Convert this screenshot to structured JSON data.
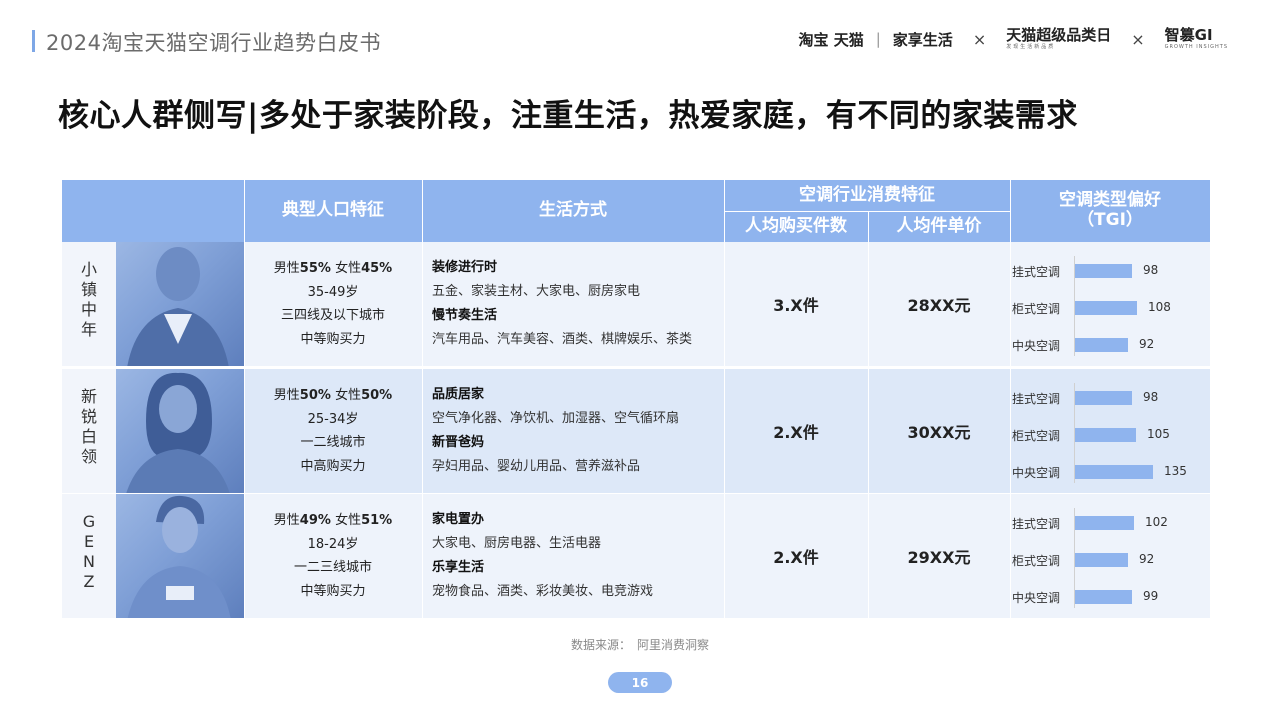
{
  "header": {
    "report_title": "2024淘宝天猫空调行业趋势白皮书",
    "logo_taobao_tmall": "淘宝 天猫",
    "logo_jiaxiang": "家享生活",
    "logo_super": "天猫超级品类日",
    "logo_super_sub": "发现生活新品质",
    "logo_zhisuan": "智篡GI",
    "logo_zhisuan_sub": "GROWTH INSIGHTS",
    "x_symbol": "×"
  },
  "headline": "核心人群侧写|多处于家装阶段，注重生活，热爱家庭，有不同的家装需求",
  "table": {
    "headers": {
      "demographics": "典型人口特征",
      "lifestyle": "生活方式",
      "consumption": "空调行业消费特征",
      "per_capita_qty": "人均购买件数",
      "per_capita_price": "人均件单价",
      "preference": "空调类型偏好",
      "preference_sub": "（TGI）"
    },
    "rows": [
      {
        "segment": "小镇中年",
        "gender_male_label": "男性",
        "gender_male_pct": "55%",
        "gender_female_label": "女性",
        "gender_female_pct": "45%",
        "age": "35-49岁",
        "city": "三四线及以下城市",
        "power": "中等购买力",
        "life1_title": "装修进行时",
        "life1_detail": "五金、家装主材、大家电、厨房家电",
        "life2_title": "慢节奏生活",
        "life2_detail": "汽车用品、汽车美容、酒类、棋牌娱乐、茶类",
        "qty": "3.X件",
        "price": "28XX元",
        "tgi": [
          {
            "label": "挂式空调",
            "value": 98
          },
          {
            "label": "柜式空调",
            "value": 108
          },
          {
            "label": "中央空调",
            "value": 92
          }
        ]
      },
      {
        "segment": "新锐白领",
        "gender_male_label": "男性",
        "gender_male_pct": "50%",
        "gender_female_label": "女性",
        "gender_female_pct": "50%",
        "age": "25-34岁",
        "city": "一二线城市",
        "power": "中高购买力",
        "life1_title": "品质居家",
        "life1_detail": "空气净化器、净饮机、加湿器、空气循环扇",
        "life2_title": "新晋爸妈",
        "life2_detail": "孕妇用品、婴幼儿用品、营养滋补品",
        "qty": "2.X件",
        "price": "30XX元",
        "tgi": [
          {
            "label": "挂式空调",
            "value": 98
          },
          {
            "label": "柜式空调",
            "value": 105
          },
          {
            "label": "中央空调",
            "value": 135
          }
        ]
      },
      {
        "segment": "GENZ",
        "gender_male_label": "男性",
        "gender_male_pct": "49%",
        "gender_female_label": "女性",
        "gender_female_pct": "51%",
        "age": "18-24岁",
        "city": "一二三线城市",
        "power": "中等购买力",
        "life1_title": "家电置办",
        "life1_detail": "大家电、厨房电器、生活电器",
        "life2_title": "乐享生活",
        "life2_detail": "宠物食品、酒类、彩妆美妆、电竞游戏",
        "qty": "2.X件",
        "price": "29XX元",
        "tgi": [
          {
            "label": "挂式空调",
            "value": 102
          },
          {
            "label": "柜式空调",
            "value": 92
          },
          {
            "label": "中央空调",
            "value": 99
          }
        ]
      }
    ]
  },
  "footer": {
    "source": "数据来源：　阿里消费洞察",
    "page_number": "16"
  },
  "colors": {
    "accent": "#8fb4ee",
    "row_light": "#eef3fb",
    "row_mid": "#dde8f8"
  }
}
